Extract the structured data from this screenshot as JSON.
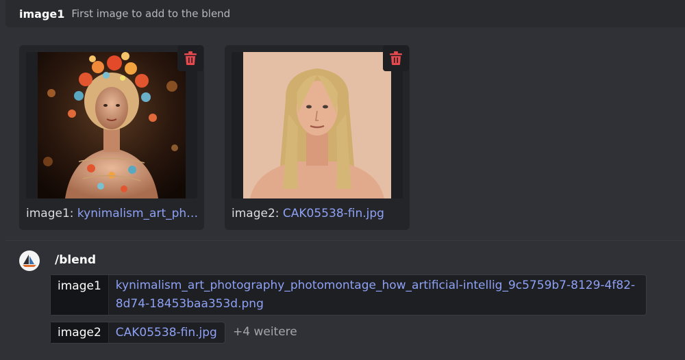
{
  "header": {
    "option_name": "image1",
    "option_description": "First image to add to the blend"
  },
  "uploads": [
    {
      "label": "image1:",
      "filename": "kynimalism_art_ph…"
    },
    {
      "label": "image2:",
      "filename": "CAK05538-fin.jpg"
    }
  ],
  "command": {
    "name": "/blend",
    "params": [
      {
        "label": "image1",
        "value": "kynimalism_art_photography_photomontage_how_artificial-intellig_9c5759b7-8129-4f82-8d74-18453baa353d.png"
      },
      {
        "label": "image2",
        "value": "CAK05538-fin.jpg"
      }
    ],
    "more": "+4 weitere"
  },
  "colors": {
    "background": "#303136",
    "link": "#8ea1f5",
    "delete": "#e5484d"
  },
  "icons": {
    "delete": "trash-icon",
    "avatar": "sailboat-logo-icon"
  }
}
